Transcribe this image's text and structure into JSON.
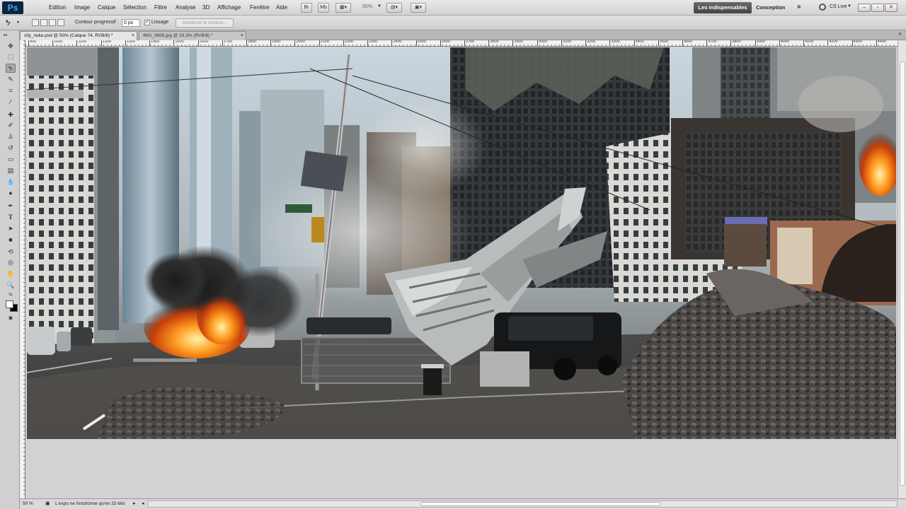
{
  "app": {
    "logo": "Ps"
  },
  "menu": {
    "items": [
      "Edition",
      "Image",
      "Calque",
      "Sélection",
      "Filtre",
      "Analyse",
      "3D",
      "Affichage",
      "Fenêtre",
      "Aide"
    ]
  },
  "app_bar": {
    "br_label": "Br",
    "mb_label": "Mb",
    "zoom": "50%",
    "workspace_active": "Les indispensables",
    "workspace_other": "Conception",
    "more_label": "»",
    "cs_live": "CS Live"
  },
  "options": {
    "feather_label": "Contour progressif :",
    "feather_value": "0 px",
    "antialias_label": "Lissage",
    "antialias_checked": true,
    "refine_label": "Améliorer le contour..."
  },
  "tabs": [
    {
      "label": "city_nuke.psd @ 50% (Calque 74, RVB/8) *",
      "active": true
    },
    {
      "label": "IMG_0656.jpg @ 33,3% (RVB/8) *",
      "active": false
    }
  ],
  "ruler": {
    "labels": [
      "900",
      "1000",
      "1100",
      "1200",
      "1300",
      "1400",
      "1500",
      "1600",
      "1700",
      "1800",
      "1900",
      "2000",
      "2100",
      "2200",
      "2300",
      "2400",
      "2500",
      "2600",
      "2700",
      "2800",
      "2900",
      "3000",
      "3100",
      "3200",
      "3300",
      "3400",
      "3500",
      "3600",
      "3700",
      "3800",
      "3900",
      "4000",
      "4100",
      "4200",
      "4300",
      "4400"
    ]
  },
  "status": {
    "zoom": "50 %",
    "info": "L'expo ne fonctionne qu'en 32-bits"
  },
  "colors": {
    "foreground": "#ffffff",
    "background": "#000000"
  }
}
